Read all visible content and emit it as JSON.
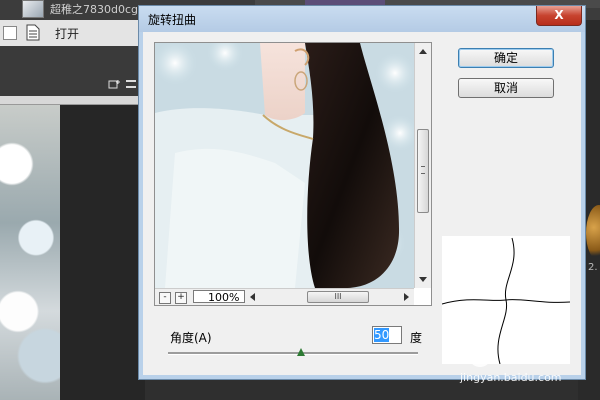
{
  "background_app": {
    "filename": "超稚之7830d0cg9f108...",
    "open_label": "打开",
    "corner_text": "2."
  },
  "dialog": {
    "title": "旋转扭曲",
    "close_glyph": "X",
    "buttons": {
      "ok": "确定",
      "cancel": "取消"
    },
    "zoom": {
      "minus": "-",
      "plus": "+",
      "value": "100%"
    },
    "hscroll_grip": "III",
    "angle": {
      "label": "角度(A)",
      "value": "50",
      "unit": "度",
      "slider_fraction": 0.53
    }
  },
  "watermark": {
    "brand": "Bai经验",
    "url": "jingyan.baidu.com"
  },
  "colors": {
    "slider_thumb": "#2d7a33",
    "accent_blue": "#3399ff",
    "title_bar": "#b4cbe5"
  }
}
